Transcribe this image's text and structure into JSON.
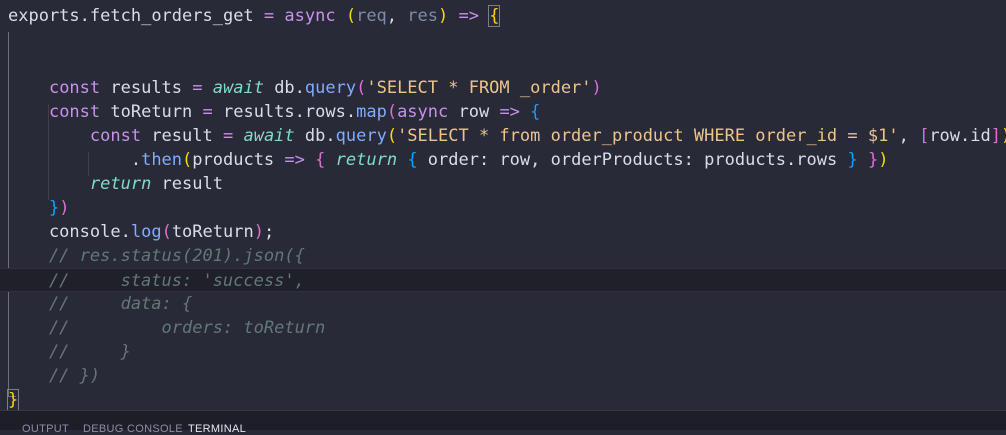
{
  "editor": {
    "lines": [
      [
        {
          "t": "exports",
          "c": "tok-plain"
        },
        {
          "t": ".",
          "c": "tok-plain"
        },
        {
          "t": "fetch_orders_get",
          "c": "tok-plain"
        },
        {
          "t": " = ",
          "c": "tok-op"
        },
        {
          "t": "async",
          "c": "tok-kw"
        },
        {
          "t": " ",
          "c": "tok-plain"
        },
        {
          "t": "(",
          "c": "tok-b1"
        },
        {
          "t": "req",
          "c": "tok-param"
        },
        {
          "t": ", ",
          "c": "tok-plain"
        },
        {
          "t": "res",
          "c": "tok-param"
        },
        {
          "t": ")",
          "c": "tok-b1"
        },
        {
          "t": " => ",
          "c": "tok-kw"
        },
        {
          "t": "{",
          "c": "tok-b1 bracket-match"
        }
      ],
      [],
      [],
      [
        {
          "t": "    ",
          "c": "tok-plain"
        },
        {
          "t": "const",
          "c": "tok-kw"
        },
        {
          "t": " results ",
          "c": "tok-plain"
        },
        {
          "t": "=",
          "c": "tok-op"
        },
        {
          "t": " ",
          "c": "tok-plain"
        },
        {
          "t": "await",
          "c": "tok-await"
        },
        {
          "t": " db",
          "c": "tok-plain"
        },
        {
          "t": ".",
          "c": "tok-plain"
        },
        {
          "t": "query",
          "c": "tok-fn"
        },
        {
          "t": "(",
          "c": "tok-b2"
        },
        {
          "t": "'SELECT * FROM _order'",
          "c": "tok-str"
        },
        {
          "t": ")",
          "c": "tok-b2"
        }
      ],
      [
        {
          "t": "    ",
          "c": "tok-plain"
        },
        {
          "t": "const",
          "c": "tok-kw"
        },
        {
          "t": " toReturn ",
          "c": "tok-plain"
        },
        {
          "t": "=",
          "c": "tok-op"
        },
        {
          "t": " results",
          "c": "tok-plain"
        },
        {
          "t": ".",
          "c": "tok-plain"
        },
        {
          "t": "rows",
          "c": "tok-plain"
        },
        {
          "t": ".",
          "c": "tok-plain"
        },
        {
          "t": "map",
          "c": "tok-fn"
        },
        {
          "t": "(",
          "c": "tok-b2"
        },
        {
          "t": "async",
          "c": "tok-kw"
        },
        {
          "t": " row ",
          "c": "tok-plain"
        },
        {
          "t": "=>",
          "c": "tok-kw"
        },
        {
          "t": " ",
          "c": "tok-plain"
        },
        {
          "t": "{",
          "c": "tok-b3"
        }
      ],
      [
        {
          "t": "        ",
          "c": "tok-plain"
        },
        {
          "t": "const",
          "c": "tok-kw"
        },
        {
          "t": " result ",
          "c": "tok-plain"
        },
        {
          "t": "=",
          "c": "tok-op"
        },
        {
          "t": " ",
          "c": "tok-plain"
        },
        {
          "t": "await",
          "c": "tok-await"
        },
        {
          "t": " db",
          "c": "tok-plain"
        },
        {
          "t": ".",
          "c": "tok-plain"
        },
        {
          "t": "query",
          "c": "tok-fn"
        },
        {
          "t": "(",
          "c": "tok-b1"
        },
        {
          "t": "'SELECT * from order_product WHERE order_id = $1'",
          "c": "tok-str"
        },
        {
          "t": ", ",
          "c": "tok-plain"
        },
        {
          "t": "[",
          "c": "tok-b2"
        },
        {
          "t": "row",
          "c": "tok-plain"
        },
        {
          "t": ".",
          "c": "tok-plain"
        },
        {
          "t": "id",
          "c": "tok-plain"
        },
        {
          "t": "]",
          "c": "tok-b2"
        },
        {
          "t": ")",
          "c": "tok-b1"
        }
      ],
      [
        {
          "t": "            ",
          "c": "tok-plain"
        },
        {
          "t": ".",
          "c": "tok-plain"
        },
        {
          "t": "then",
          "c": "tok-fn"
        },
        {
          "t": "(",
          "c": "tok-b1"
        },
        {
          "t": "products ",
          "c": "tok-plain"
        },
        {
          "t": "=>",
          "c": "tok-kw"
        },
        {
          "t": " ",
          "c": "tok-plain"
        },
        {
          "t": "{",
          "c": "tok-b2"
        },
        {
          "t": " ",
          "c": "tok-plain"
        },
        {
          "t": "return",
          "c": "tok-await"
        },
        {
          "t": " ",
          "c": "tok-plain"
        },
        {
          "t": "{",
          "c": "tok-b3"
        },
        {
          "t": " order: row, orderProducts: products",
          "c": "tok-plain"
        },
        {
          "t": ".",
          "c": "tok-plain"
        },
        {
          "t": "rows ",
          "c": "tok-plain"
        },
        {
          "t": "}",
          "c": "tok-b3"
        },
        {
          "t": " ",
          "c": "tok-plain"
        },
        {
          "t": "}",
          "c": "tok-b2"
        },
        {
          "t": ")",
          "c": "tok-b1"
        }
      ],
      [
        {
          "t": "        ",
          "c": "tok-plain"
        },
        {
          "t": "return",
          "c": "tok-await"
        },
        {
          "t": " result",
          "c": "tok-plain"
        }
      ],
      [
        {
          "t": "    ",
          "c": "tok-plain"
        },
        {
          "t": "}",
          "c": "tok-b3"
        },
        {
          "t": ")",
          "c": "tok-b2"
        }
      ],
      [
        {
          "t": "    console",
          "c": "tok-plain"
        },
        {
          "t": ".",
          "c": "tok-plain"
        },
        {
          "t": "log",
          "c": "tok-fn"
        },
        {
          "t": "(",
          "c": "tok-b2"
        },
        {
          "t": "toReturn",
          "c": "tok-plain"
        },
        {
          "t": ")",
          "c": "tok-b2"
        },
        {
          "t": ";",
          "c": "tok-plain"
        }
      ],
      [
        {
          "t": "    // res.status(201).json({",
          "c": "tok-comment"
        }
      ],
      [
        {
          "t": "    //     status: 'success',",
          "c": "tok-comment"
        }
      ],
      [
        {
          "t": "    //     data: {",
          "c": "tok-comment"
        }
      ],
      [
        {
          "t": "    //         orders: toReturn",
          "c": "tok-comment"
        }
      ],
      [
        {
          "t": "    //     }",
          "c": "tok-comment"
        }
      ],
      [
        {
          "t": "    // })",
          "c": "tok-comment"
        }
      ],
      [
        {
          "t": "}",
          "c": "tok-b1 bracket-match"
        }
      ]
    ],
    "active_line": 11
  },
  "panel": {
    "tabs": [
      {
        "label": "OUTPUT",
        "active": false
      },
      {
        "label": "DEBUG CONSOLE",
        "active": false
      },
      {
        "label": "TERMINAL",
        "active": true
      }
    ]
  },
  "colors": {
    "background": "#292a37",
    "active_line": "#1f2029",
    "string": "#ecc48d",
    "keyword": "#c792ea",
    "function": "#82aaff",
    "comment": "#637777"
  }
}
